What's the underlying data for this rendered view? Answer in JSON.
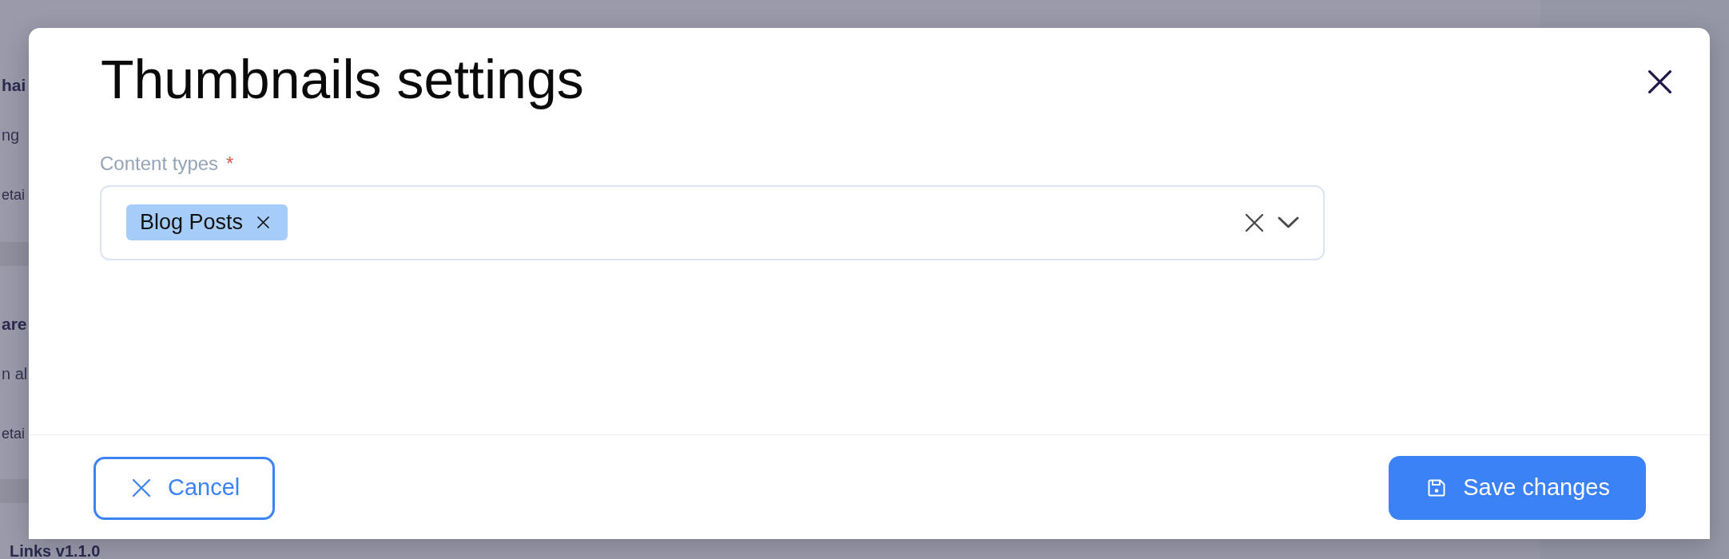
{
  "background": {
    "cards": [
      {
        "heading": "hai",
        "description": "ng",
        "link": "etai"
      },
      {
        "heading": "are",
        "description": "n al",
        "link": "etai"
      },
      {
        "heading": "Links v1.1.0"
      }
    ]
  },
  "dialog": {
    "title": "Thumbnails settings",
    "field": {
      "label": "Content types",
      "required_mark": "*",
      "chips": [
        {
          "label": "Blog Posts"
        }
      ]
    },
    "buttons": [
      {
        "label": "Cancel",
        "kind": "secondary"
      },
      {
        "label": "Save changes",
        "kind": "primary"
      }
    ]
  }
}
